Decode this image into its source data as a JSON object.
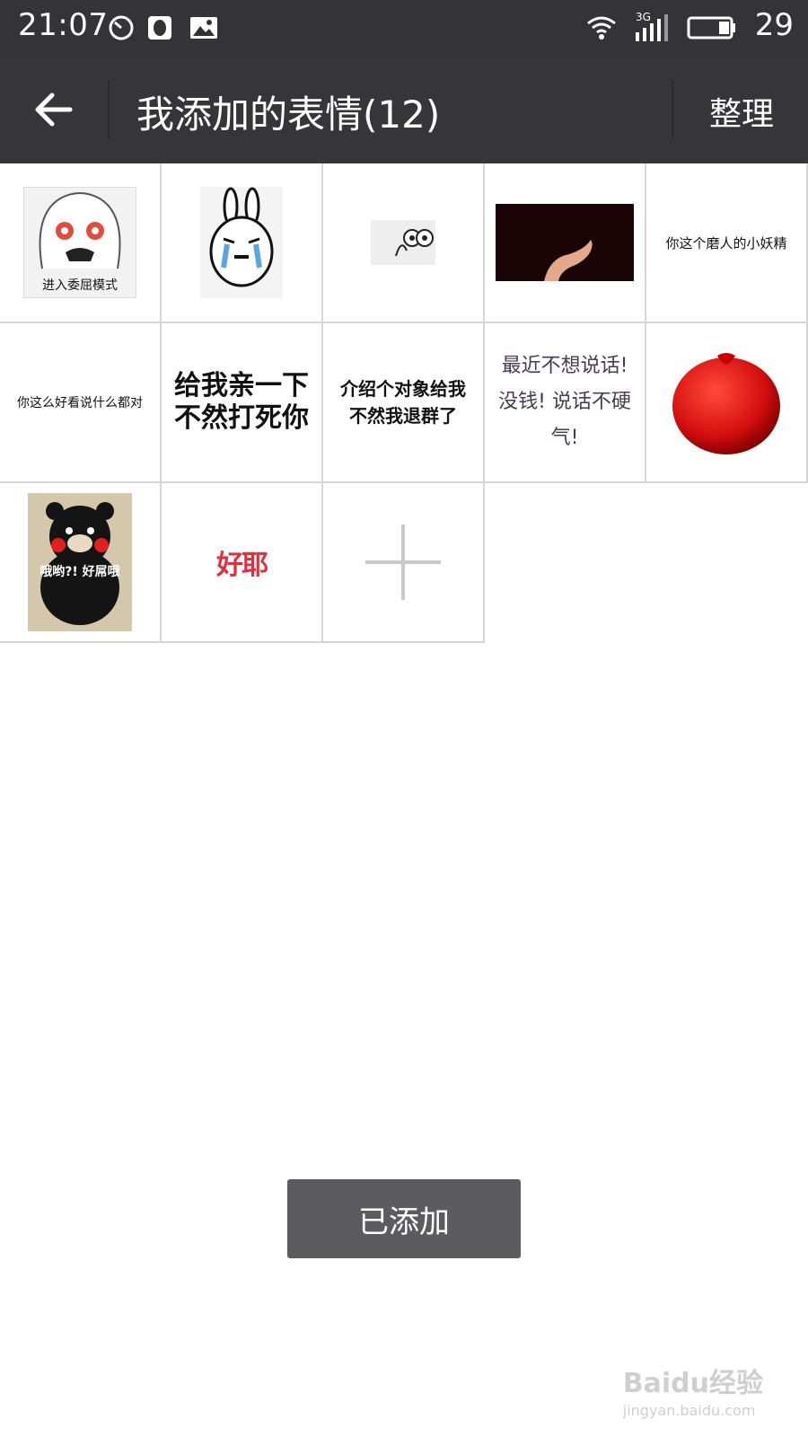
{
  "status_bar": {
    "time": "21:07",
    "network": "3G",
    "battery": "29",
    "icons": [
      "clock-icon",
      "qq-icon",
      "image-icon",
      "wifi-icon",
      "signal-icon",
      "battery-icon"
    ]
  },
  "app_bar": {
    "title": "我添加的表情(12)",
    "action": "整理"
  },
  "stickers": [
    {
      "label": "进入委屈模式"
    },
    {
      "label": ""
    },
    {
      "label": ""
    },
    {
      "label": ""
    },
    {
      "label": "你这个磨人的小妖精"
    },
    {
      "label": "你这么好看说什么都对"
    },
    {
      "label": "给我亲一下 不然打死你"
    },
    {
      "label": "介绍个对象给我 不然我退群了"
    },
    {
      "label": "最近不想说话! 没钱! 说话不硬气!"
    },
    {
      "label": ""
    },
    {
      "label": "哦哟?! 好屌哦"
    },
    {
      "label": "好耶"
    }
  ],
  "add_button_label": "",
  "bottom_button": "已添加",
  "watermark": {
    "brand": "Baidu经验",
    "url": "jingyan.baidu.com"
  }
}
